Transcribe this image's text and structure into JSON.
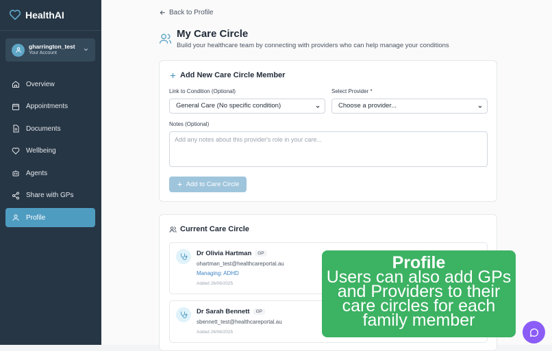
{
  "app": {
    "name": "HealthAI"
  },
  "account": {
    "username": "gharrington_test",
    "subtitle": "Your Account"
  },
  "nav": [
    {
      "label": "Overview",
      "icon": "home-icon"
    },
    {
      "label": "Appointments",
      "icon": "calendar-icon"
    },
    {
      "label": "Documents",
      "icon": "document-icon"
    },
    {
      "label": "Wellbeing",
      "icon": "heart-icon"
    },
    {
      "label": "Agents",
      "icon": "robot-icon"
    },
    {
      "label": "Share with GPs",
      "icon": "share-icon"
    },
    {
      "label": "Profile",
      "icon": "user-icon",
      "active": true
    }
  ],
  "page": {
    "back_link": "Back to Profile",
    "title": "My Care Circle",
    "subtitle": "Build your healthcare team by connecting with providers who can help manage your conditions"
  },
  "add_form": {
    "title": "Add New Care Circle Member",
    "condition_label": "Link to Condition (Optional)",
    "condition_value": "General Care (No specific condition)",
    "provider_label": "Select Provider *",
    "provider_value": "Choose a provider...",
    "notes_label": "Notes (Optional)",
    "notes_placeholder": "Add any notes about this provider's role in your care...",
    "submit_label": "Add to Care Circle"
  },
  "care_circle": {
    "title": "Current Care Circle",
    "members": [
      {
        "name": "Dr Olivia Hartman",
        "role": "GP",
        "email": "ohartman_test@healthcareportal.au",
        "managing": "Managing: ADHD",
        "added": "Added 26/06/2025"
      },
      {
        "name": "Dr Sarah Bennett",
        "role": "GP",
        "email": "sbennett_test@healthcareportal.au",
        "added": "Added 26/06/2025"
      }
    ]
  },
  "overlay": {
    "title": "Profile",
    "body": [
      "Users can also add GPs",
      "and Providers to their",
      "care circles for each",
      "family member"
    ]
  },
  "colors": {
    "sidebar": "#263645",
    "accent": "#4f9cc1",
    "overlay": "#3cb263",
    "chat": "#8b5cf6"
  }
}
